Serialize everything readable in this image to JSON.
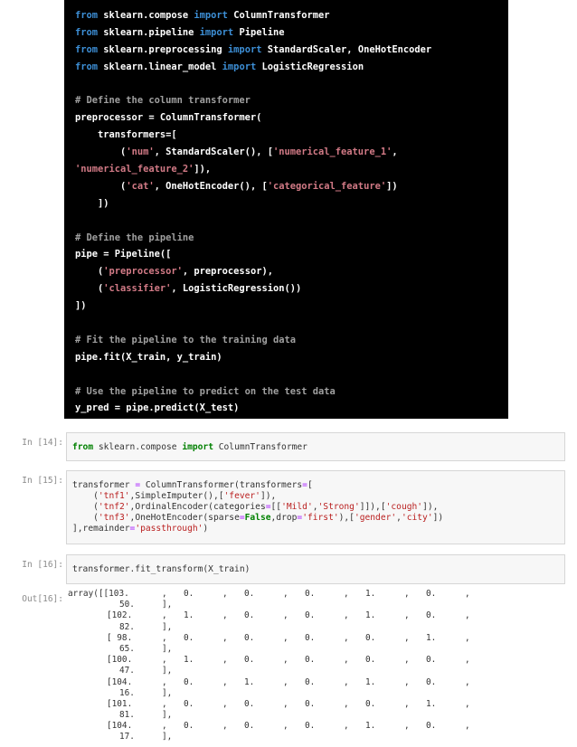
{
  "dark_code": {
    "lines": [
      [
        {
          "t": "from",
          "c": "k"
        },
        {
          "t": " sklearn.compose ",
          "c": "p"
        },
        {
          "t": "import",
          "c": "k"
        },
        {
          "t": " ColumnTransformer",
          "c": "p"
        }
      ],
      [
        {
          "t": "from",
          "c": "k"
        },
        {
          "t": " sklearn.pipeline ",
          "c": "p"
        },
        {
          "t": "import",
          "c": "k"
        },
        {
          "t": " Pipeline",
          "c": "p"
        }
      ],
      [
        {
          "t": "from",
          "c": "k"
        },
        {
          "t": " sklearn.preprocessing ",
          "c": "p"
        },
        {
          "t": "import",
          "c": "k"
        },
        {
          "t": " StandardScaler, OneHotEncoder",
          "c": "p"
        }
      ],
      [
        {
          "t": "from",
          "c": "k"
        },
        {
          "t": " sklearn.linear_model ",
          "c": "p"
        },
        {
          "t": "import",
          "c": "k"
        },
        {
          "t": " LogisticRegression",
          "c": "p"
        }
      ],
      [],
      [
        {
          "t": "# Define the column transformer",
          "c": "c"
        }
      ],
      [
        {
          "t": "preprocessor = ColumnTransformer(",
          "c": "p"
        }
      ],
      [
        {
          "t": "    transformers=[",
          "c": "p"
        }
      ],
      [
        {
          "t": "        (",
          "c": "p"
        },
        {
          "t": "'num'",
          "c": "s"
        },
        {
          "t": ", StandardScaler(), [",
          "c": "p"
        },
        {
          "t": "'numerical_feature_1'",
          "c": "s"
        },
        {
          "t": ",",
          "c": "p"
        }
      ],
      [
        {
          "t": "'numerical_feature_2'",
          "c": "s"
        },
        {
          "t": "]),",
          "c": "p"
        }
      ],
      [
        {
          "t": "        (",
          "c": "p"
        },
        {
          "t": "'cat'",
          "c": "s"
        },
        {
          "t": ", OneHotEncoder(), [",
          "c": "p"
        },
        {
          "t": "'categorical_feature'",
          "c": "s"
        },
        {
          "t": "])",
          "c": "p"
        }
      ],
      [
        {
          "t": "    ])",
          "c": "p"
        }
      ],
      [],
      [
        {
          "t": "# Define the pipeline",
          "c": "c"
        }
      ],
      [
        {
          "t": "pipe = Pipeline([",
          "c": "p"
        }
      ],
      [
        {
          "t": "    (",
          "c": "p"
        },
        {
          "t": "'preprocessor'",
          "c": "s"
        },
        {
          "t": ", preprocessor),",
          "c": "p"
        }
      ],
      [
        {
          "t": "    (",
          "c": "p"
        },
        {
          "t": "'classifier'",
          "c": "s"
        },
        {
          "t": ", LogisticRegression())",
          "c": "p"
        }
      ],
      [
        {
          "t": "])",
          "c": "p"
        }
      ],
      [],
      [
        {
          "t": "# Fit the pipeline to the training data",
          "c": "c"
        }
      ],
      [
        {
          "t": "pipe.fit(X_train, y_train)",
          "c": "p"
        }
      ],
      [],
      [
        {
          "t": "# Use the pipeline to predict on the test data",
          "c": "c"
        }
      ],
      [
        {
          "t": "y_pred = pipe.predict(X_test)",
          "c": "p"
        }
      ]
    ]
  },
  "cells": [
    {
      "prompt": "In [14]:",
      "lines": [
        [
          {
            "t": "from",
            "c": "kw"
          },
          {
            "t": " sklearn.compose ",
            "c": "n"
          },
          {
            "t": "import",
            "c": "kw"
          },
          {
            "t": " ColumnTransformer",
            "c": "n"
          }
        ]
      ]
    },
    {
      "prompt": "In [15]:",
      "lines": [
        [
          {
            "t": "transformer ",
            "c": "n"
          },
          {
            "t": "=",
            "c": "op"
          },
          {
            "t": " ColumnTransformer(transformers",
            "c": "n"
          },
          {
            "t": "=",
            "c": "op"
          },
          {
            "t": "[",
            "c": "n"
          }
        ],
        [
          {
            "t": "    (",
            "c": "n"
          },
          {
            "t": "'tnf1'",
            "c": "st"
          },
          {
            "t": ",SimpleImputer(),[",
            "c": "n"
          },
          {
            "t": "'fever'",
            "c": "st"
          },
          {
            "t": "]),",
            "c": "n"
          }
        ],
        [
          {
            "t": "    (",
            "c": "n"
          },
          {
            "t": "'tnf2'",
            "c": "st"
          },
          {
            "t": ",OrdinalEncoder(categories",
            "c": "n"
          },
          {
            "t": "=",
            "c": "op"
          },
          {
            "t": "[[",
            "c": "n"
          },
          {
            "t": "'Mild'",
            "c": "st"
          },
          {
            "t": ",",
            "c": "n"
          },
          {
            "t": "'Strong'",
            "c": "st"
          },
          {
            "t": "]]),[",
            "c": "n"
          },
          {
            "t": "'cough'",
            "c": "st"
          },
          {
            "t": "]),",
            "c": "n"
          }
        ],
        [
          {
            "t": "    (",
            "c": "n"
          },
          {
            "t": "'tnf3'",
            "c": "st"
          },
          {
            "t": ",OneHotEncoder(sparse",
            "c": "n"
          },
          {
            "t": "=",
            "c": "op"
          },
          {
            "t": "False",
            "c": "kw"
          },
          {
            "t": ",drop",
            "c": "n"
          },
          {
            "t": "=",
            "c": "op"
          },
          {
            "t": "'first'",
            "c": "st"
          },
          {
            "t": "),[",
            "c": "n"
          },
          {
            "t": "'gender'",
            "c": "st"
          },
          {
            "t": ",",
            "c": "n"
          },
          {
            "t": "'city'",
            "c": "st"
          },
          {
            "t": "])",
            "c": "n"
          }
        ],
        [
          {
            "t": "],remainder",
            "c": "n"
          },
          {
            "t": "=",
            "c": "op"
          },
          {
            "t": "'passthrough'",
            "c": "st"
          },
          {
            "t": ")",
            "c": "n"
          }
        ]
      ]
    },
    {
      "prompt": "In [16]:",
      "lines": [
        [
          {
            "t": "transformer.fit_transform(X_train)",
            "c": "n"
          }
        ]
      ]
    }
  ],
  "output": {
    "prompt": "Out[16]:",
    "prefix": "array([",
    "rows": [
      {
        "first": "[103.",
        "vals": [
          "0.",
          "0.",
          "0.",
          "1.",
          "0."
        ],
        "last": "50."
      },
      {
        "first": "[102.",
        "vals": [
          "1.",
          "0.",
          "0.",
          "1.",
          "0."
        ],
        "last": "82."
      },
      {
        "first": "[ 98.",
        "vals": [
          "0.",
          "0.",
          "0.",
          "0.",
          "1."
        ],
        "last": "65."
      },
      {
        "first": "[100.",
        "vals": [
          "1.",
          "0.",
          "0.",
          "0.",
          "0."
        ],
        "last": "47."
      },
      {
        "first": "[104.",
        "vals": [
          "0.",
          "1.",
          "0.",
          "1.",
          "0."
        ],
        "last": "16."
      },
      {
        "first": "[101.",
        "vals": [
          "0.",
          "0.",
          "0.",
          "0.",
          "1."
        ],
        "last": "81."
      },
      {
        "first": "[104.",
        "vals": [
          "0.",
          "0.",
          "0.",
          "1.",
          "0."
        ],
        "last": "17."
      }
    ],
    "sep": ",",
    "row_end": "],"
  }
}
